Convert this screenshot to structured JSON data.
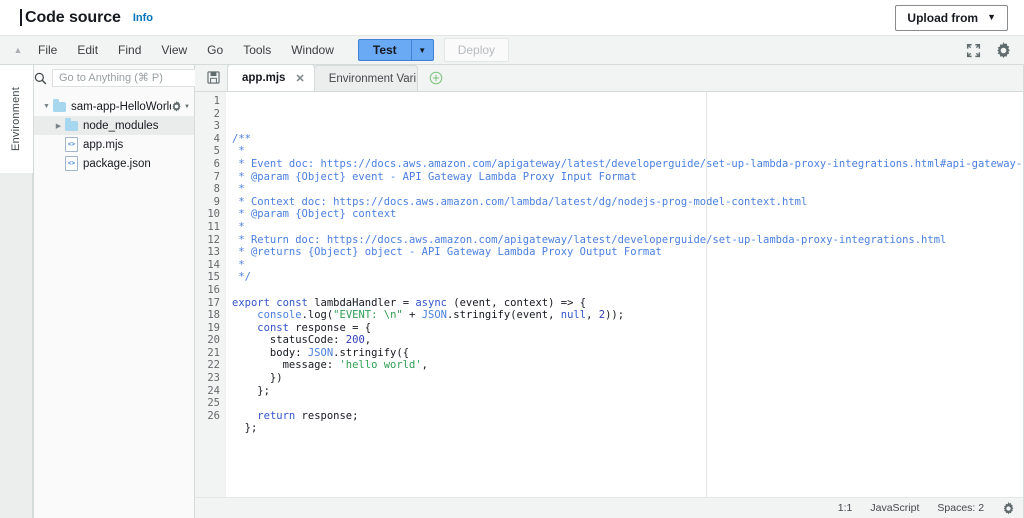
{
  "header": {
    "title": "Code source",
    "info_label": "Info",
    "upload_button": "Upload from",
    "upload_caret_icon": "chevron-down-icon"
  },
  "menubar": {
    "collapse_icon": "triangle-up-icon",
    "items": [
      "File",
      "Edit",
      "Find",
      "View",
      "Go",
      "Tools",
      "Window"
    ],
    "test_label": "Test",
    "test_caret_icon": "chevron-down-icon",
    "deploy_label": "Deploy",
    "expand_icon": "fullscreen-icon",
    "settings_icon": "gear-icon"
  },
  "sidebar": {
    "rail_label": "Environment",
    "search_icon": "search-icon",
    "search_placeholder": "Go to Anything (⌘ P)",
    "search_value": "",
    "tree": [
      {
        "label": "sam-app-HelloWorld",
        "icon": "folder-icon",
        "twisty": "caret-down-icon",
        "depth": 0,
        "selected": false,
        "gear": true
      },
      {
        "label": "node_modules",
        "icon": "folder-icon",
        "twisty": "caret-right-icon",
        "depth": 1,
        "selected": true,
        "gear": false
      },
      {
        "label": "app.mjs",
        "icon": "code-file-icon",
        "twisty": "",
        "depth": 2,
        "selected": false,
        "gear": false
      },
      {
        "label": "package.json",
        "icon": "code-file-icon",
        "twisty": "",
        "depth": 2,
        "selected": false,
        "gear": false
      }
    ],
    "folder_gear_icon": "gear-icon",
    "folder_gear_caret": "caret-down-icon"
  },
  "editor": {
    "save_icon": "save-disk-icon",
    "tabs": [
      {
        "label": "app.mjs",
        "active": true,
        "close_icon": "close-icon"
      },
      {
        "label": "Environment Vari",
        "active": false,
        "close_icon": "close-icon"
      }
    ],
    "add_tab_icon": "plus-circle-icon",
    "first_line": 1,
    "last_line": 26,
    "lines": [
      [
        {
          "t": "/**",
          "c": "cm"
        }
      ],
      [
        {
          "t": " *",
          "c": "cm"
        }
      ],
      [
        {
          "t": " * Event doc: https://docs.aws.amazon.com/apigateway/latest/developerguide/set-up-lambda-proxy-integrations.html#api-gateway-simple-proxy-",
          "c": "cm"
        }
      ],
      [
        {
          "t": " * @param {Object} event - API Gateway Lambda Proxy Input Format",
          "c": "cm"
        }
      ],
      [
        {
          "t": " *",
          "c": "cm"
        }
      ],
      [
        {
          "t": " * Context doc: https://docs.aws.amazon.com/lambda/latest/dg/nodejs-prog-model-context.html",
          "c": "cm"
        }
      ],
      [
        {
          "t": " * @param {Object} context",
          "c": "cm"
        }
      ],
      [
        {
          "t": " *",
          "c": "cm"
        }
      ],
      [
        {
          "t": " * Return doc: https://docs.aws.amazon.com/apigateway/latest/developerguide/set-up-lambda-proxy-integrations.html",
          "c": "cm"
        }
      ],
      [
        {
          "t": " * @returns {Object} object - API Gateway Lambda Proxy Output Format",
          "c": "cm"
        }
      ],
      [
        {
          "t": " *",
          "c": "cm"
        }
      ],
      [
        {
          "t": " */",
          "c": "cm"
        }
      ],
      [],
      [
        {
          "t": "export",
          "c": "kw"
        },
        {
          "t": " ",
          "c": "pl"
        },
        {
          "t": "const",
          "c": "kw"
        },
        {
          "t": " lambdaHandler ",
          "c": "pl"
        },
        {
          "t": "=",
          "c": "pl"
        },
        {
          "t": " ",
          "c": "pl"
        },
        {
          "t": "async",
          "c": "kw"
        },
        {
          "t": " (event, context) ",
          "c": "pl"
        },
        {
          "t": "=>",
          "c": "pl"
        },
        {
          "t": " {",
          "c": "pl"
        }
      ],
      [
        {
          "t": "    ",
          "c": "pl"
        },
        {
          "t": "console",
          "c": "fn"
        },
        {
          "t": ".log(",
          "c": "pl"
        },
        {
          "t": "\"EVENT: \\n\"",
          "c": "str"
        },
        {
          "t": " + ",
          "c": "pl"
        },
        {
          "t": "JSON",
          "c": "fn"
        },
        {
          "t": ".stringify(event, ",
          "c": "pl"
        },
        {
          "t": "null",
          "c": "kw"
        },
        {
          "t": ", ",
          "c": "pl"
        },
        {
          "t": "2",
          "c": "num"
        },
        {
          "t": "));",
          "c": "pl"
        }
      ],
      [
        {
          "t": "    ",
          "c": "pl"
        },
        {
          "t": "const",
          "c": "kw"
        },
        {
          "t": " response = {",
          "c": "pl"
        }
      ],
      [
        {
          "t": "      statusCode: ",
          "c": "pl"
        },
        {
          "t": "200",
          "c": "num"
        },
        {
          "t": ",",
          "c": "pl"
        }
      ],
      [
        {
          "t": "      body: ",
          "c": "pl"
        },
        {
          "t": "JSON",
          "c": "fn"
        },
        {
          "t": ".stringify({",
          "c": "pl"
        }
      ],
      [
        {
          "t": "        message: ",
          "c": "pl"
        },
        {
          "t": "'hello world'",
          "c": "str"
        },
        {
          "t": ",",
          "c": "pl"
        }
      ],
      [
        {
          "t": "      })",
          "c": "pl"
        }
      ],
      [
        {
          "t": "    };",
          "c": "pl"
        }
      ],
      [],
      [
        {
          "t": "    ",
          "c": "pl"
        },
        {
          "t": "return",
          "c": "kw"
        },
        {
          "t": " response;",
          "c": "pl"
        }
      ],
      [
        {
          "t": "  };",
          "c": "pl"
        }
      ],
      [],
      []
    ]
  },
  "statusbar": {
    "cursor_position": "1:1",
    "language": "JavaScript",
    "indent": "Spaces: 2",
    "settings_icon": "gear-icon"
  },
  "colors": {
    "accent_blue": "#0073bb",
    "test_button": "#6aa9f4",
    "comment": "#4a7fe0",
    "string": "#2e9e53",
    "keyword": "#3355cc",
    "number": "#2e3bb8",
    "folder": "#a7d7ef"
  }
}
